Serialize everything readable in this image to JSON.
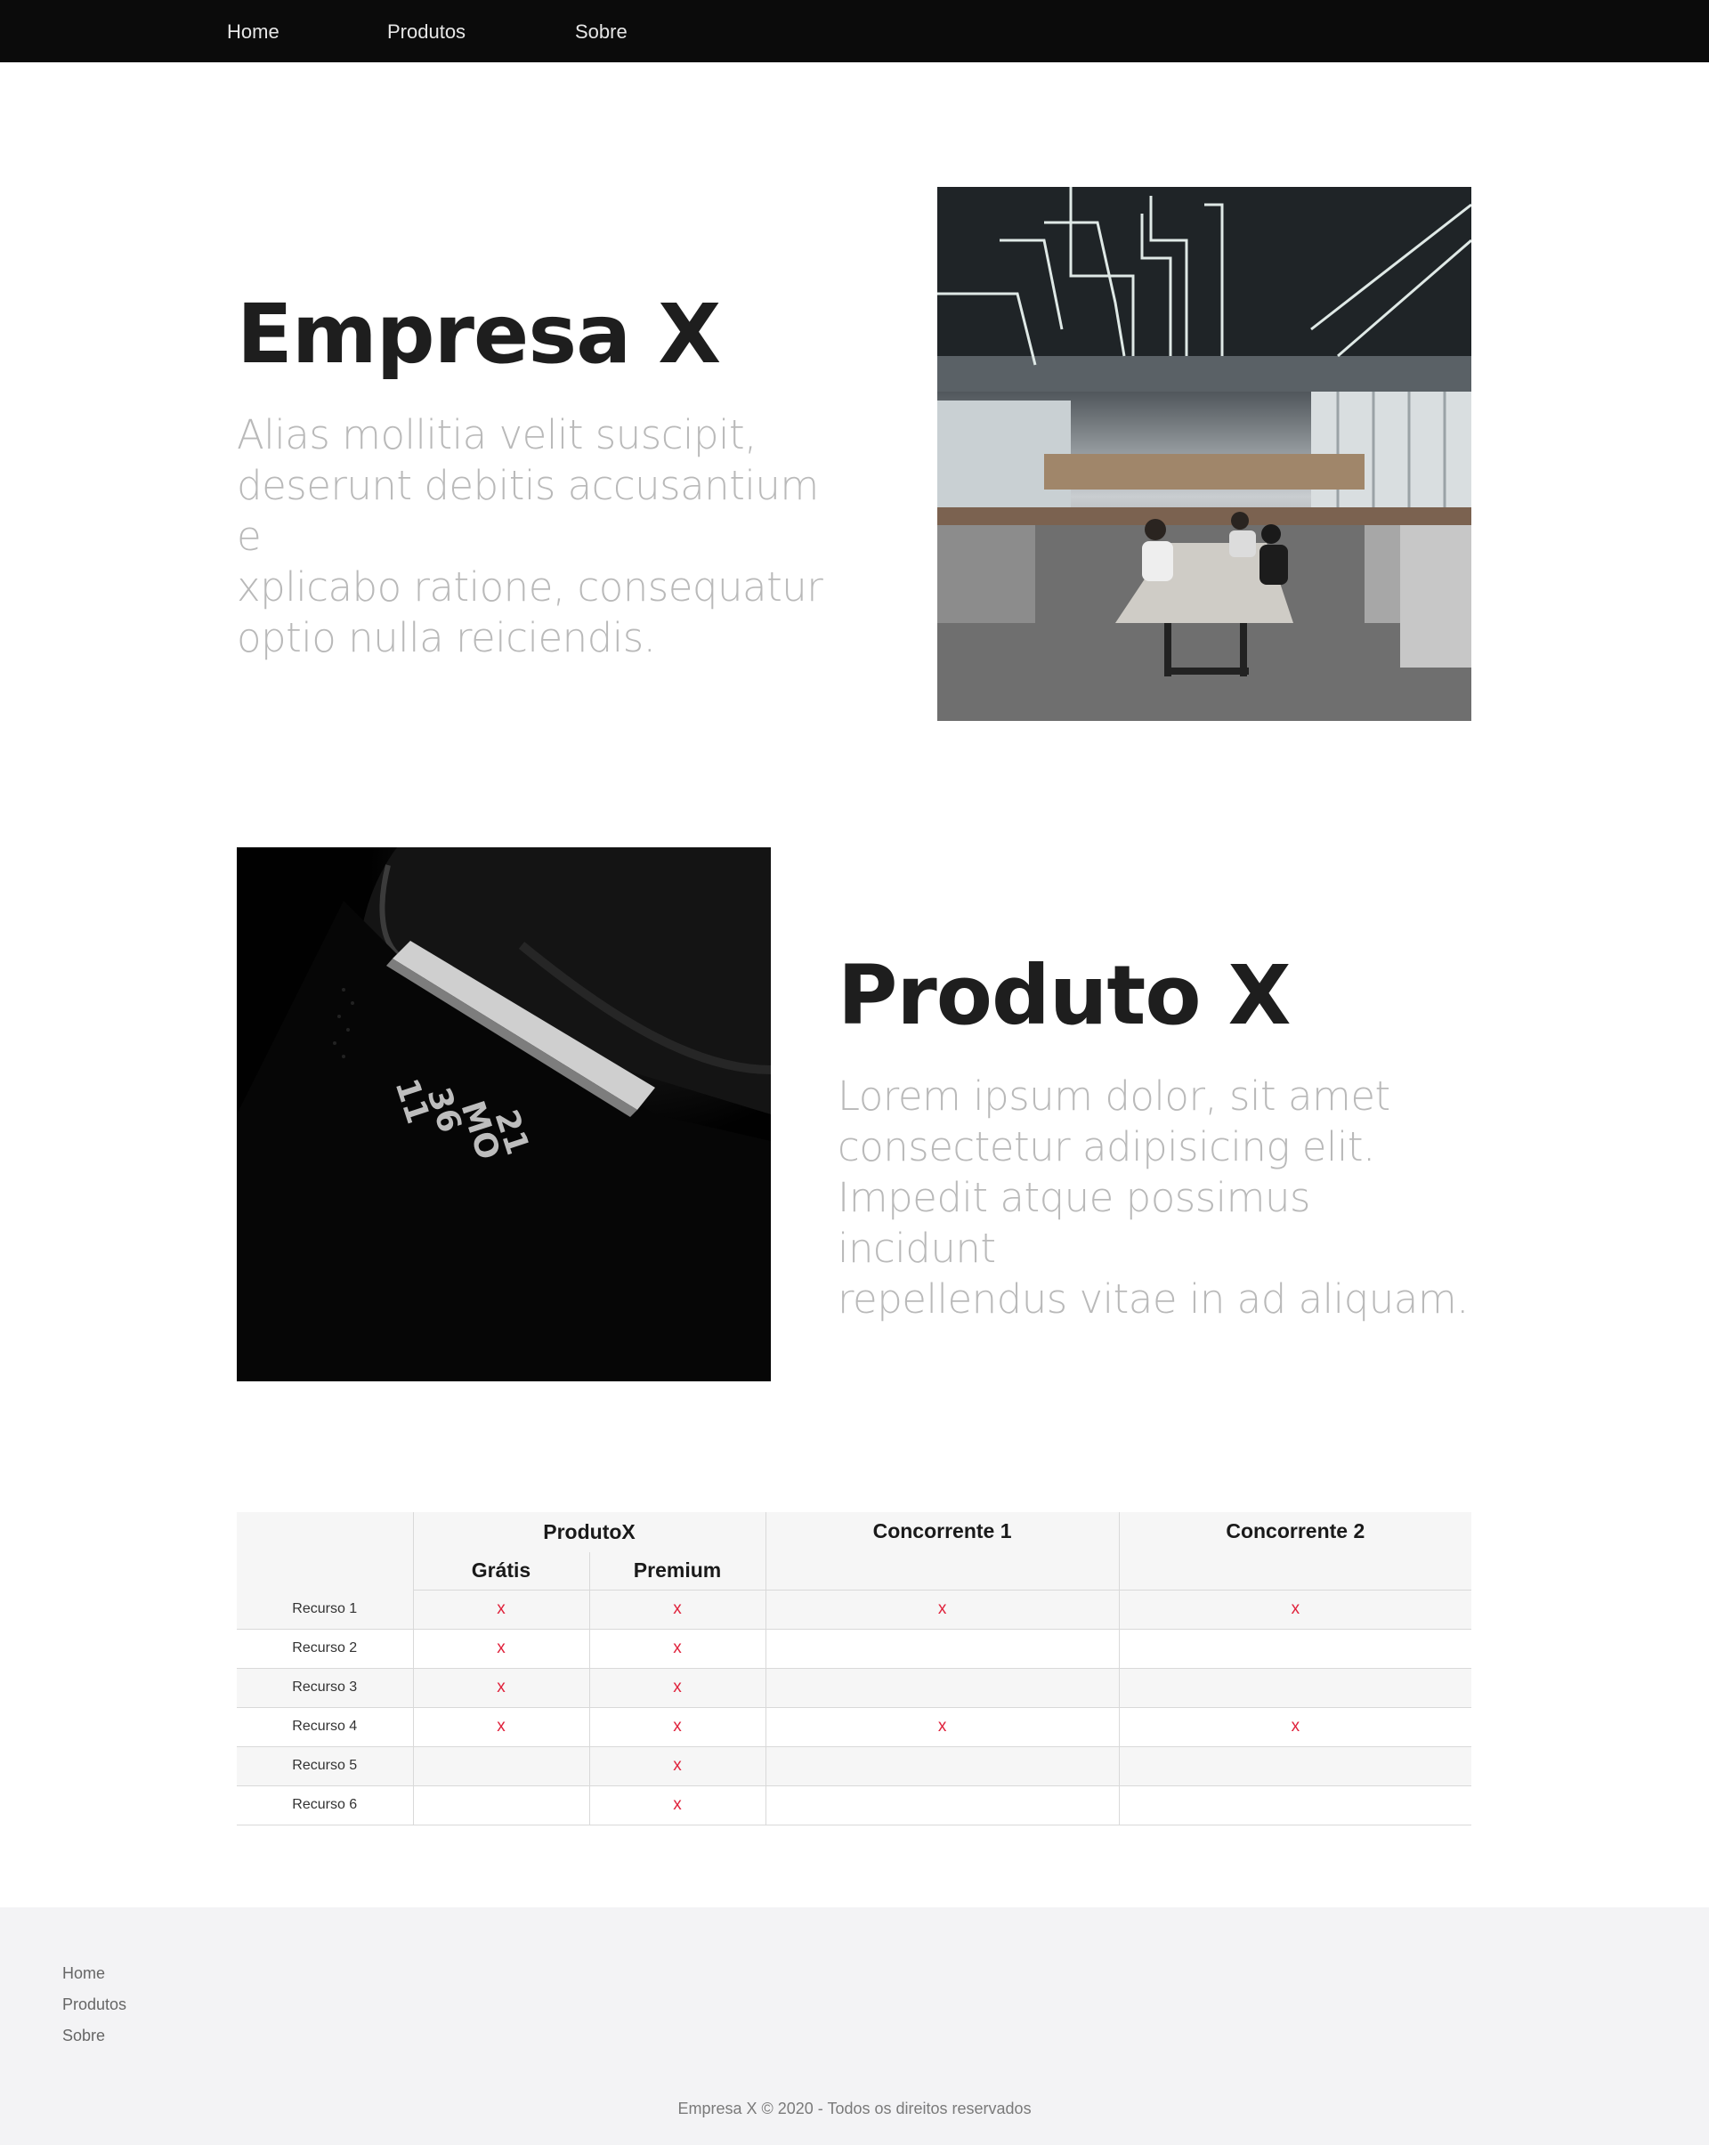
{
  "nav": {
    "items": [
      {
        "label": "Home"
      },
      {
        "label": "Produtos"
      },
      {
        "label": "Sobre"
      }
    ]
  },
  "section_company": {
    "title": "Empresa X",
    "text_lines": [
      "Alias mollitia velit suscipit,",
      "deserunt debitis accusantium e",
      "xplicabo ratione, consequatur",
      "optio nulla reiciendis."
    ]
  },
  "section_product": {
    "title": "Produto X",
    "text_lines": [
      "Lorem ipsum dolor, sit amet",
      "consectetur adipisicing elit.",
      "Impedit atque possimus incidunt",
      "repellendus vitae in ad aliquam."
    ],
    "watch_text": [
      "11",
      "36",
      "MO",
      "21"
    ]
  },
  "comparison": {
    "headers": {
      "product": "ProdutoX",
      "free": "Grátis",
      "premium": "Premium",
      "competitor1": "Concorrente 1",
      "competitor2": "Concorrente 2"
    },
    "mark": "x",
    "rows": [
      {
        "label": "Recurso 1",
        "free": "x",
        "premium": "x",
        "c1": "x",
        "c2": "x"
      },
      {
        "label": "Recurso 2",
        "free": "x",
        "premium": "x",
        "c1": "",
        "c2": ""
      },
      {
        "label": "Recurso 3",
        "free": "x",
        "premium": "x",
        "c1": "",
        "c2": ""
      },
      {
        "label": "Recurso 4",
        "free": "x",
        "premium": "x",
        "c1": "x",
        "c2": "x"
      },
      {
        "label": "Recurso 5",
        "free": "",
        "premium": "x",
        "c1": "",
        "c2": ""
      },
      {
        "label": "Recurso 6",
        "free": "",
        "premium": "x",
        "c1": "",
        "c2": ""
      }
    ]
  },
  "footer": {
    "links": [
      {
        "label": "Home"
      },
      {
        "label": "Produtos"
      },
      {
        "label": "Sobre"
      }
    ],
    "copyright": "Empresa X © 2020 - Todos os direitos reservados"
  },
  "colors": {
    "nav_bg": "#0b0b0b",
    "heading": "#1e1e1e",
    "lead_text": "#b9b9b9",
    "mark": "#e0223c",
    "footer_bg": "#f3f3f5"
  }
}
